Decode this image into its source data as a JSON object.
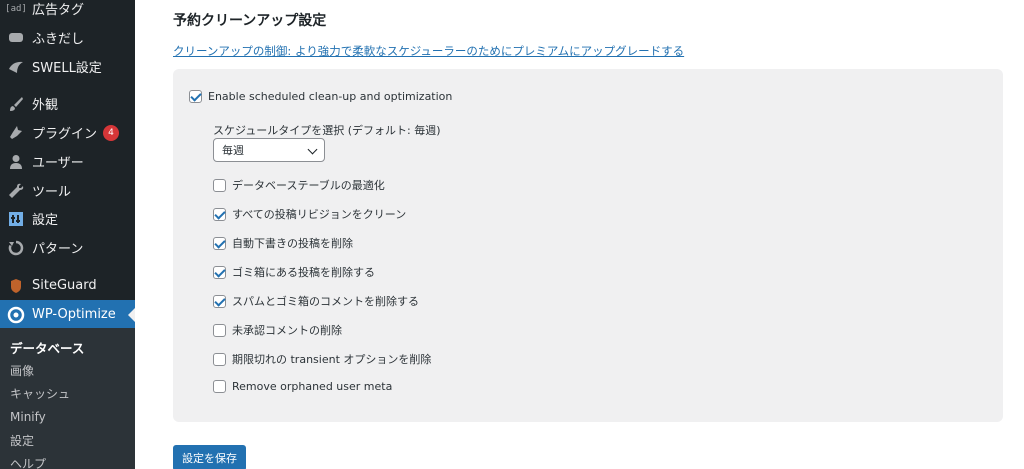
{
  "sidebar": {
    "items": [
      {
        "label": "広告タグ",
        "icon": "ad-tag-icon",
        "badge": null
      },
      {
        "label": "ふきだし",
        "icon": "speech-bubble-icon",
        "badge": null
      },
      {
        "label": "SWELL設定",
        "icon": "swell-icon",
        "badge": null
      },
      {
        "label": "外観",
        "icon": "paintbrush-icon",
        "badge": null
      },
      {
        "label": "プラグイン",
        "icon": "plugin-icon",
        "badge": "4"
      },
      {
        "label": "ユーザー",
        "icon": "user-icon",
        "badge": null
      },
      {
        "label": "ツール",
        "icon": "wrench-icon",
        "badge": null
      },
      {
        "label": "設定",
        "icon": "settings-icon",
        "badge": null
      },
      {
        "label": "パターン",
        "icon": "pattern-icon",
        "badge": null
      },
      {
        "label": "SiteGuard",
        "icon": "siteguard-icon",
        "badge": null
      },
      {
        "label": "WP-Optimize",
        "icon": "wp-optimize-icon",
        "badge": null
      }
    ],
    "ad_box_text": "[ad]",
    "submenu": [
      "データベース",
      "画像",
      "キャッシュ",
      "Minify",
      "設定",
      "ヘルプ"
    ]
  },
  "main": {
    "heading": "予約クリーンアップ設定",
    "upgrade_link": "クリーンアップの制御: より強力で柔軟なスケジューラーのためにプレミアムにアップグレードする",
    "enable_label": "Enable scheduled clean-up and optimization",
    "enable_checked": true,
    "schedule_label": "スケジュールタイプを選択 (デフォルト: 毎週)",
    "schedule_value": "毎週",
    "options": [
      {
        "label": "データベーステーブルの最適化",
        "checked": false
      },
      {
        "label": "すべての投稿リビジョンをクリーン",
        "checked": true
      },
      {
        "label": "自動下書きの投稿を削除",
        "checked": true
      },
      {
        "label": "ゴミ箱にある投稿を削除する",
        "checked": true
      },
      {
        "label": "スパムとゴミ箱のコメントを削除する",
        "checked": true
      },
      {
        "label": "未承認コメントの削除",
        "checked": false
      },
      {
        "label": "期限切れの transient オプションを削除",
        "checked": false
      },
      {
        "label": "Remove orphaned user meta",
        "checked": false
      }
    ],
    "save_label": "設定を保存"
  },
  "colors": {
    "sidebar_bg": "#1d2327",
    "submenu_bg": "#2c3338",
    "accent": "#2271b1",
    "badge": "#d63638",
    "panel_bg": "#f0f0f1"
  }
}
